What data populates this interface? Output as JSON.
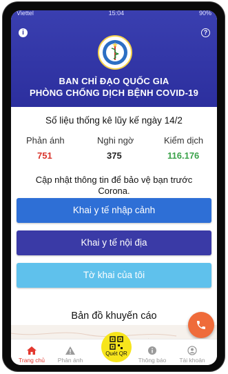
{
  "statusbar": {
    "carrier": "Viettel",
    "time": "15:04",
    "battery": "90%"
  },
  "header": {
    "title_line1": "BAN CHỈ ĐẠO QUỐC GIA",
    "title_line2": "PHÒNG CHỐNG DỊCH BỆNH COVID-19",
    "info_glyph": "i",
    "help_glyph": "?"
  },
  "stats": {
    "title": "Số liệu thống kê lũy kế ngày 14/2",
    "items": [
      {
        "label": "Phản ánh",
        "value": "751",
        "color": "#d9342b"
      },
      {
        "label": "Nghi ngờ",
        "value": "375",
        "color": "#222222"
      },
      {
        "label": "Kiểm dịch",
        "value": "116.176",
        "color": "#3aa24a"
      }
    ]
  },
  "update_text": "Cập nhật thông tin để bảo vệ bạn trước Corona.",
  "buttons": [
    {
      "label": "Khai y tế nhập cảnh",
      "color": "#2e6fd6"
    },
    {
      "label": "Khai y tế nội địa",
      "color": "#3a3aa6"
    },
    {
      "label": "Tờ khai của tôi",
      "color": "#5fc1ec"
    }
  ],
  "map_title": "Bản đồ khuyến cáo",
  "nav": {
    "items": [
      {
        "label": "Trang chủ",
        "icon": "home-icon"
      },
      {
        "label": "Phản ánh",
        "icon": "warning-icon"
      },
      {
        "label": "Quét QR",
        "icon": "qr-icon"
      },
      {
        "label": "Thông báo",
        "icon": "info-icon"
      },
      {
        "label": "Tài khoản",
        "icon": "account-icon"
      }
    ]
  },
  "colors": {
    "header": "#2c2f9e",
    "active": "#e3382f",
    "fab": "#ef6b3a",
    "qr": "#f7e51c"
  }
}
